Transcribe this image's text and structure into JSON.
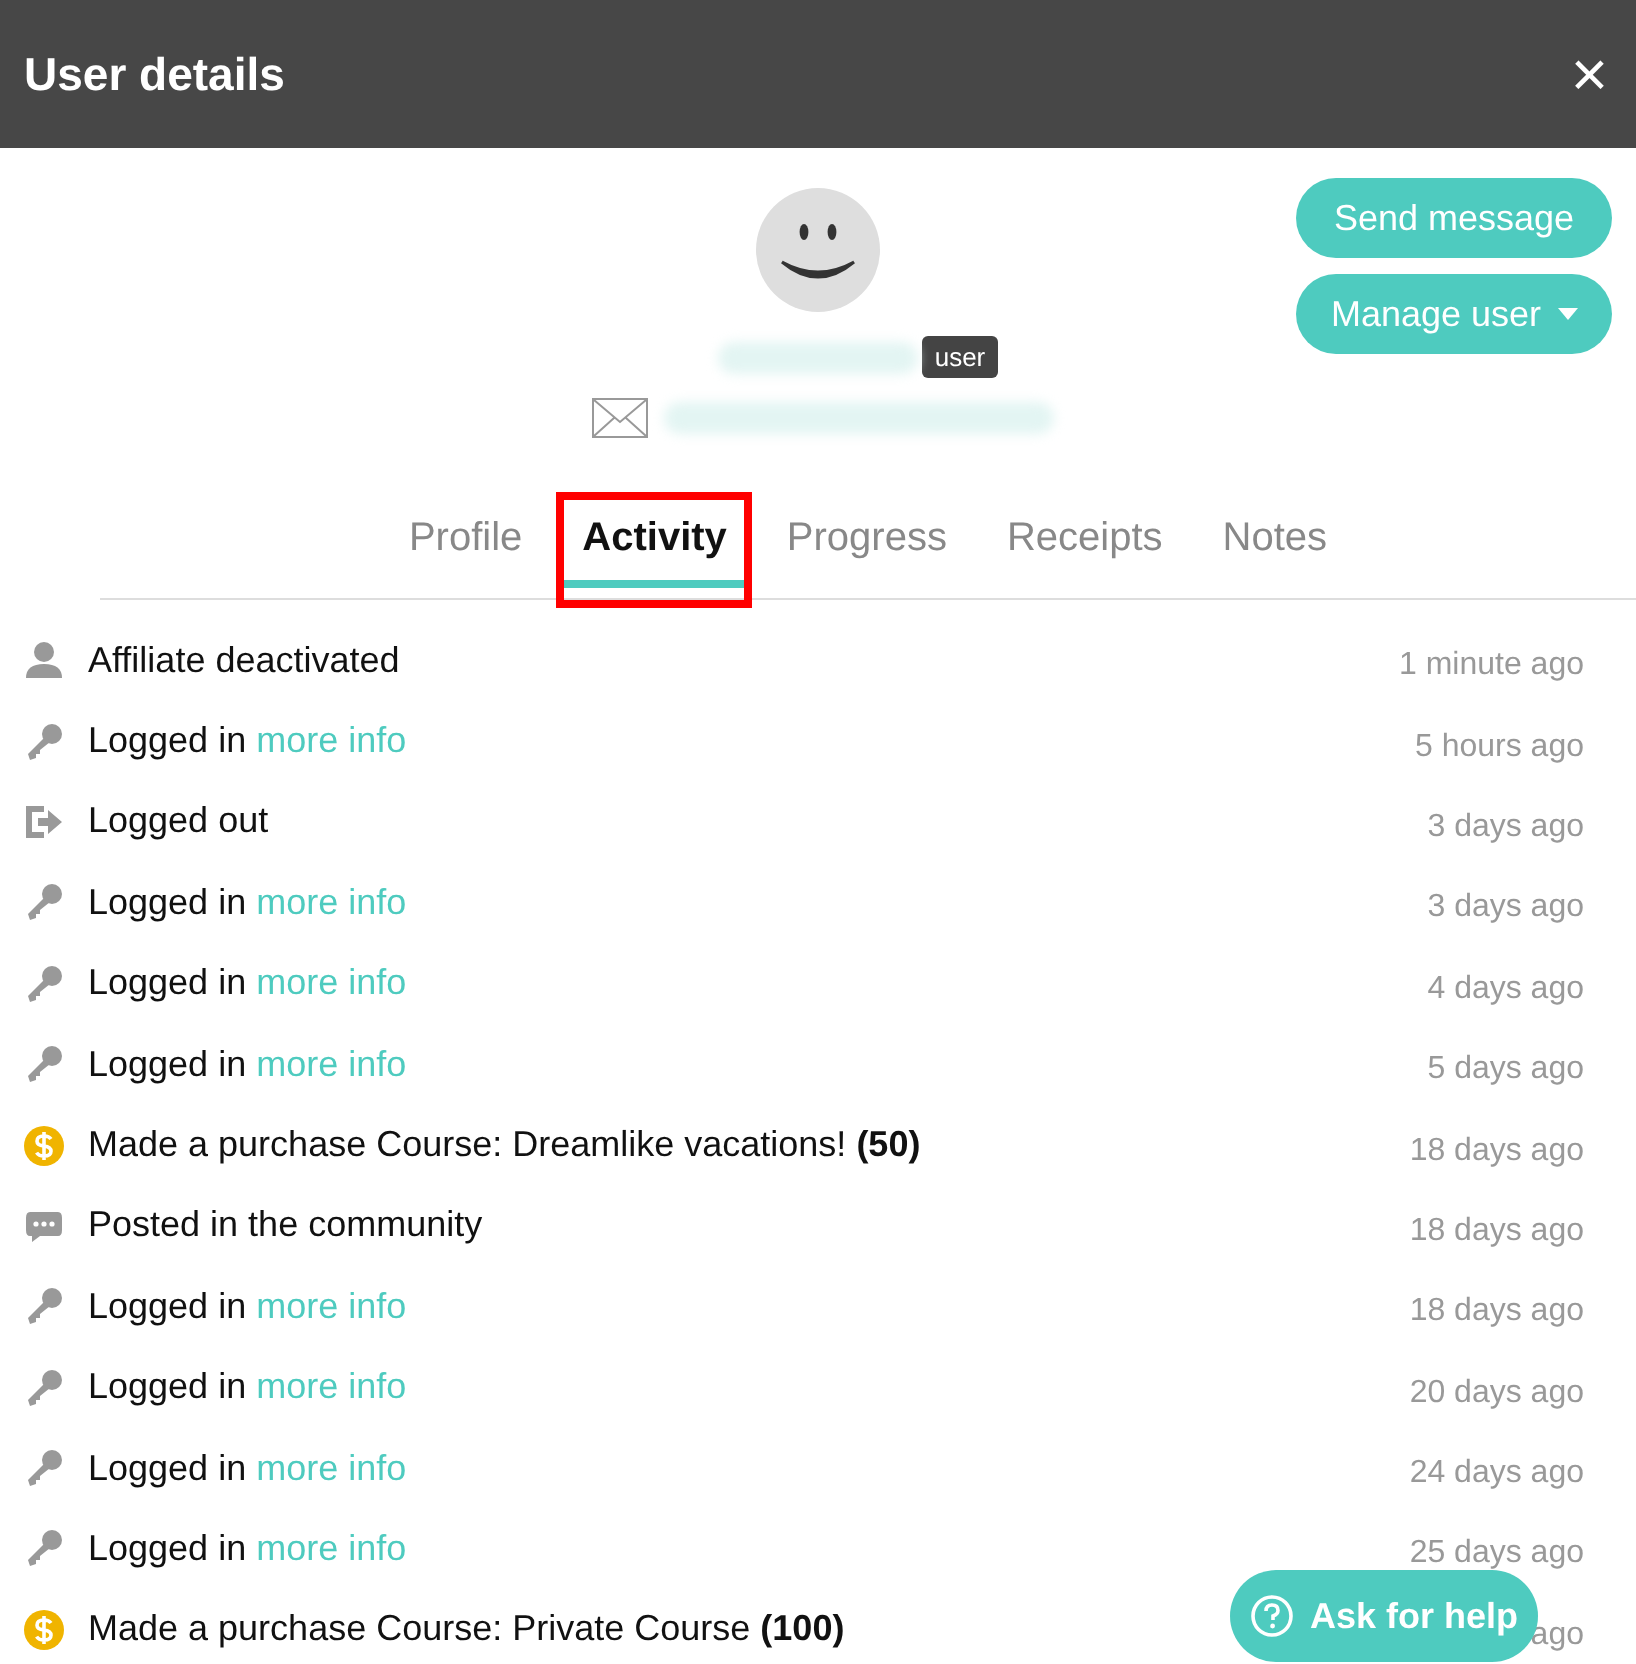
{
  "window": {
    "title": "User details",
    "close": "×"
  },
  "profile": {
    "role_badge": "user",
    "actions": [
      {
        "label": "Send message",
        "kind": "plain"
      },
      {
        "label": "Manage user",
        "kind": "dropdown"
      }
    ]
  },
  "tabs": [
    {
      "label": "Profile",
      "selected": false,
      "highlighted": false
    },
    {
      "label": "Activity",
      "selected": true,
      "highlighted": true
    },
    {
      "label": "Progress",
      "selected": false,
      "highlighted": false
    },
    {
      "label": "Receipts",
      "selected": false,
      "highlighted": false
    },
    {
      "label": "Notes",
      "selected": false,
      "highlighted": false
    }
  ],
  "activity": [
    {
      "kind": "affiliate",
      "text": "Affiliate deactivated",
      "time": "1 minute ago"
    },
    {
      "kind": "login",
      "text": "Logged in",
      "link": "more info",
      "time": "5 hours ago"
    },
    {
      "kind": "logout",
      "text": "Logged out",
      "time": "3 days ago"
    },
    {
      "kind": "login",
      "text": "Logged in",
      "link": "more info",
      "time": "3 days ago"
    },
    {
      "kind": "login",
      "text": "Logged in",
      "link": "more info",
      "time": "4 days ago"
    },
    {
      "kind": "login",
      "text": "Logged in",
      "link": "more info",
      "time": "5 days ago"
    },
    {
      "kind": "purchase",
      "text": "Made a purchase Course: Dreamlike vacations! **(50)**",
      "time": "18 days ago"
    },
    {
      "kind": "post",
      "text": "Posted in the community",
      "time": "18 days ago"
    },
    {
      "kind": "login",
      "text": "Logged in",
      "link": "more info",
      "time": "18 days ago"
    },
    {
      "kind": "login",
      "text": "Logged in",
      "link": "more info",
      "time": "20 days ago"
    },
    {
      "kind": "login",
      "text": "Logged in",
      "link": "more info",
      "time": "24 days ago"
    },
    {
      "kind": "login",
      "text": "Logged in",
      "link": "more info",
      "time": "25 days ago"
    },
    {
      "kind": "purchase",
      "text": "Made a purchase Course: Private Course **(100)**",
      "time": "ago"
    }
  ],
  "help_button": {
    "label": "Ask for help"
  }
}
